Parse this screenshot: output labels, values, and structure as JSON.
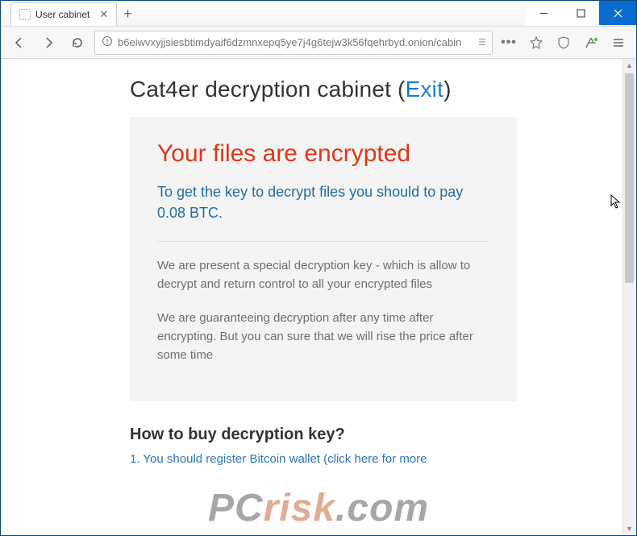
{
  "window": {
    "tab_title": "User cabinet",
    "url": "b6eiwvxyjjsiesbtimdyaif6dzmnxepq5ye7j4g6tejw3k56fqehrbyd.onion/cabin"
  },
  "page": {
    "title_pre": "Cat4er decryption cabinet (",
    "title_link": "Exit",
    "title_post": ")",
    "heading": "Your files are encrypted",
    "subtext": "To get the key to decrypt files you should to pay 0.08 BTC.",
    "para1": "We are present a special decryption key - which is allow to decrypt and return control to all your encrypted files",
    "para2": "We are guaranteeing decryption after any time after encrypting. But you can sure that we will rise the price after some time",
    "section2_title": "How to buy decryption key?",
    "cutoff_line": "1. You should register Bitcoin wallet (click here for more"
  },
  "watermark": {
    "pre": "PC",
    "mid": "risk",
    "post": ".com"
  }
}
